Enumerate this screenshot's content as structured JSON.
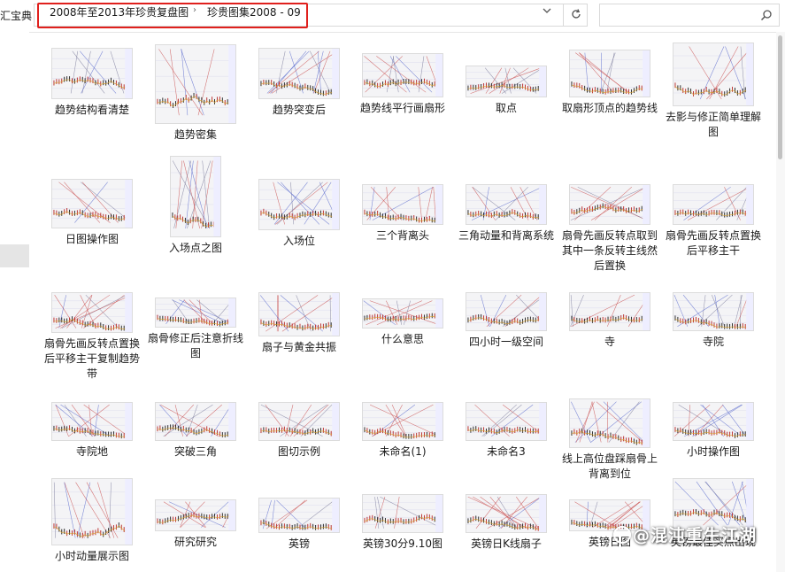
{
  "nav": {
    "left_crumb": "汇宝典",
    "breadcrumb": [
      "2008年至2013年珍贵复盘图",
      "珍贵图集2008 - 09"
    ],
    "separator": "›"
  },
  "search": {
    "placeholder": ""
  },
  "icons": {
    "dropdown": "chevron-down-icon",
    "refresh": "refresh-icon",
    "search": "search-icon"
  },
  "colors": {
    "highlight": "#e0201d",
    "chart_bg": "#f4f4f6"
  },
  "files": [
    {
      "label": "趋势结构看清楚"
    },
    {
      "label": "趋势密集"
    },
    {
      "label": "趋势突变后"
    },
    {
      "label": "趋势线平行画扇形"
    },
    {
      "label": "取点"
    },
    {
      "label": "取扇形顶点的趋势线"
    },
    {
      "label": "去影与修正简单理解图"
    },
    {
      "label": "日图操作图"
    },
    {
      "label": "入场点之图"
    },
    {
      "label": "入场位"
    },
    {
      "label": "三个背离头"
    },
    {
      "label": "三角动量和背离系统"
    },
    {
      "label": "扇骨先画反转点取到其中一条反转主线然后置换"
    },
    {
      "label": "扇骨先画反转点置换后平移主干"
    },
    {
      "label": "扇骨先画反转点置换后平移主干复制趋势带"
    },
    {
      "label": "扇骨修正后注意折线图"
    },
    {
      "label": "扇子与黄金共振"
    },
    {
      "label": "什么意思"
    },
    {
      "label": "四小时一级空间"
    },
    {
      "label": "寺"
    },
    {
      "label": "寺院"
    },
    {
      "label": "寺院地"
    },
    {
      "label": "突破三角"
    },
    {
      "label": "图切示例"
    },
    {
      "label": "未命名(1)"
    },
    {
      "label": "未命名3"
    },
    {
      "label": "线上高位盘踩扇骨上背离到位"
    },
    {
      "label": "小时操作图"
    },
    {
      "label": "小时动量展示图"
    },
    {
      "label": "研究研究"
    },
    {
      "label": "英镑"
    },
    {
      "label": "英镑30分9.10图"
    },
    {
      "label": "英镑日K线扇子"
    },
    {
      "label": "英镑日图"
    },
    {
      "label": "英镑最佳买点出现"
    }
  ],
  "watermark": "@混沌重生江湖"
}
